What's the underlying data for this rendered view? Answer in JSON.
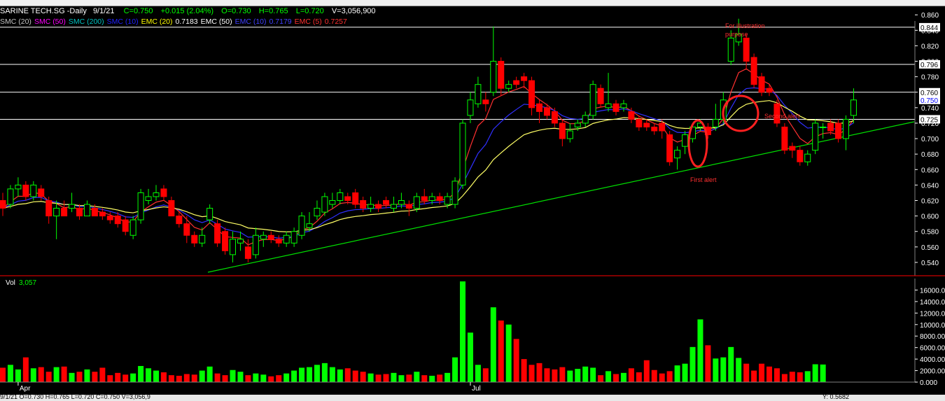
{
  "header": {
    "ticker": "SARINE TECH.SG -Daily",
    "date": "9/1/21",
    "close": "C=0.750",
    "change": "+0.015 (2.04%)",
    "open": "O=0.730",
    "high": "H=0.765",
    "low": "L=0.720",
    "volume": "V=3,056,900"
  },
  "indicators": [
    {
      "label": "SMC (20)",
      "color": "#c0c0c0"
    },
    {
      "label": "SMC (50)",
      "color": "#ff00ff"
    },
    {
      "label": "SMC (200)",
      "color": "#00c0c0"
    },
    {
      "label": "SMC (10)",
      "color": "#2020ff"
    },
    {
      "label": "EMC (20)",
      "color": "#ffff00"
    },
    {
      "label": "0.7183",
      "color": "#ffffff"
    },
    {
      "label": "EMC (50)",
      "color": "#ffffff"
    },
    {
      "label": "EMC (10)",
      "color": "#4040ff"
    },
    {
      "label": "0.7179",
      "color": "#4040ff"
    },
    {
      "label": "EMC (5)",
      "color": "#ff3030"
    },
    {
      "label": "0.7257",
      "color": "#ff3030"
    }
  ],
  "annotations": {
    "illustration": "For illustration purpose",
    "first_alert": "First alert",
    "second_alert": "Second alert"
  },
  "volume_label": {
    "name": "Vol",
    "value": "3,057"
  },
  "x_labels": [
    "Apr",
    "Jul"
  ],
  "statusbar": {
    "left": "9/1/21   O=0.730   H=0.765   L=0.720   C=0.750   V=3,056,9",
    "right": "Y: 0.5682"
  },
  "colors": {
    "up": "#00ff00",
    "down": "#ff0000",
    "trendline": "#00e000",
    "grid": "#ffffff",
    "ema5": "#ff3030",
    "ema10": "#3030ff",
    "ema20": "#ffff66",
    "alert_circle": "#ff2020"
  },
  "chart_data": [
    {
      "type": "candlestick",
      "title": "SARINE TECH.SG -Daily",
      "ylim": [
        0.53,
        0.862
      ],
      "yticks": [
        0.54,
        0.56,
        0.58,
        0.6,
        0.62,
        0.64,
        0.66,
        0.68,
        0.7,
        0.72,
        0.74,
        0.76,
        0.78,
        0.8,
        0.82,
        0.84,
        0.86
      ],
      "ytick_labels": [
        "0.540",
        "0.560",
        "0.580",
        "0.600",
        "0.620",
        "0.640",
        "0.660",
        "0.680",
        "0.700",
        "0.720",
        "0.740",
        "0.760",
        "0.780",
        "0.800",
        "0.820",
        "0.840",
        "0.860"
      ],
      "horizontal_levels": [
        {
          "value": 0.844,
          "label": "0.844"
        },
        {
          "value": 0.796,
          "label": "0.796"
        },
        {
          "value": 0.76,
          "label": "0.760"
        },
        {
          "value": 0.725,
          "label": "0.725"
        }
      ],
      "last_price": {
        "value": 0.75,
        "label": "0.750"
      },
      "bars": [
        [
          0.62,
          0.61,
          0.63,
          0.6
        ],
        [
          0.615,
          0.635,
          0.64,
          0.61
        ],
        [
          0.635,
          0.64,
          0.65,
          0.625
        ],
        [
          0.64,
          0.625,
          0.645,
          0.62
        ],
        [
          0.625,
          0.64,
          0.645,
          0.62
        ],
        [
          0.635,
          0.625,
          0.64,
          0.62
        ],
        [
          0.62,
          0.6,
          0.625,
          0.59
        ],
        [
          0.6,
          0.61,
          0.62,
          0.57
        ],
        [
          0.61,
          0.6,
          0.62,
          0.6
        ],
        [
          0.61,
          0.615,
          0.63,
          0.605
        ],
        [
          0.61,
          0.6,
          0.615,
          0.595
        ],
        [
          0.6,
          0.615,
          0.62,
          0.6
        ],
        [
          0.61,
          0.6,
          0.615,
          0.6
        ],
        [
          0.605,
          0.6,
          0.61,
          0.595
        ],
        [
          0.6,
          0.595,
          0.605,
          0.59
        ],
        [
          0.6,
          0.59,
          0.605,
          0.585
        ],
        [
          0.595,
          0.58,
          0.6,
          0.575
        ],
        [
          0.575,
          0.595,
          0.6,
          0.57
        ],
        [
          0.595,
          0.63,
          0.635,
          0.59
        ],
        [
          0.62,
          0.625,
          0.635,
          0.615
        ],
        [
          0.625,
          0.63,
          0.64,
          0.62
        ],
        [
          0.635,
          0.625,
          0.64,
          0.62
        ],
        [
          0.62,
          0.6,
          0.625,
          0.6
        ],
        [
          0.6,
          0.59,
          0.605,
          0.585
        ],
        [
          0.59,
          0.575,
          0.6,
          0.565
        ],
        [
          0.575,
          0.565,
          0.58,
          0.56
        ],
        [
          0.565,
          0.575,
          0.585,
          0.56
        ],
        [
          0.595,
          0.61,
          0.615,
          0.59
        ],
        [
          0.59,
          0.565,
          0.595,
          0.56
        ],
        [
          0.58,
          0.555,
          0.585,
          0.55
        ],
        [
          0.55,
          0.57,
          0.58,
          0.54
        ],
        [
          0.565,
          0.57,
          0.58,
          0.555
        ],
        [
          0.56,
          0.545,
          0.57,
          0.54
        ],
        [
          0.55,
          0.575,
          0.585,
          0.545
        ],
        [
          0.57,
          0.575,
          0.58,
          0.56
        ],
        [
          0.575,
          0.57,
          0.58,
          0.565
        ],
        [
          0.57,
          0.565,
          0.575,
          0.56
        ],
        [
          0.565,
          0.575,
          0.58,
          0.56
        ],
        [
          0.565,
          0.58,
          0.585,
          0.56
        ],
        [
          0.575,
          0.6,
          0.605,
          0.57
        ],
        [
          0.585,
          0.59,
          0.605,
          0.58
        ],
        [
          0.6,
          0.61,
          0.62,
          0.595
        ],
        [
          0.605,
          0.625,
          0.63,
          0.6
        ],
        [
          0.615,
          0.62,
          0.63,
          0.61
        ],
        [
          0.62,
          0.63,
          0.635,
          0.615
        ],
        [
          0.625,
          0.62,
          0.63,
          0.615
        ],
        [
          0.63,
          0.615,
          0.635,
          0.61
        ],
        [
          0.62,
          0.61,
          0.625,
          0.605
        ],
        [
          0.61,
          0.615,
          0.625,
          0.605
        ],
        [
          0.615,
          0.61,
          0.62,
          0.605
        ],
        [
          0.62,
          0.615,
          0.625,
          0.61
        ],
        [
          0.61,
          0.615,
          0.625,
          0.605
        ],
        [
          0.615,
          0.62,
          0.63,
          0.61
        ],
        [
          0.615,
          0.61,
          0.62,
          0.6
        ],
        [
          0.61,
          0.625,
          0.63,
          0.605
        ],
        [
          0.625,
          0.62,
          0.635,
          0.615
        ],
        [
          0.62,
          0.625,
          0.63,
          0.615
        ],
        [
          0.625,
          0.62,
          0.63,
          0.615
        ],
        [
          0.615,
          0.625,
          0.63,
          0.61
        ],
        [
          0.615,
          0.645,
          0.65,
          0.61
        ],
        [
          0.64,
          0.72,
          0.725,
          0.635
        ],
        [
          0.73,
          0.75,
          0.76,
          0.72
        ],
        [
          0.745,
          0.77,
          0.78,
          0.74
        ],
        [
          0.75,
          0.745,
          0.76,
          0.735
        ],
        [
          0.76,
          0.8,
          0.845,
          0.755
        ],
        [
          0.8,
          0.765,
          0.805,
          0.755
        ],
        [
          0.765,
          0.77,
          0.775,
          0.76
        ],
        [
          0.775,
          0.77,
          0.78,
          0.765
        ],
        [
          0.78,
          0.775,
          0.785,
          0.765
        ],
        [
          0.775,
          0.74,
          0.78,
          0.73
        ],
        [
          0.745,
          0.735,
          0.75,
          0.72
        ],
        [
          0.74,
          0.73,
          0.745,
          0.725
        ],
        [
          0.735,
          0.72,
          0.74,
          0.715
        ],
        [
          0.72,
          0.7,
          0.725,
          0.69
        ],
        [
          0.7,
          0.71,
          0.72,
          0.695
        ],
        [
          0.715,
          0.72,
          0.725,
          0.71
        ],
        [
          0.72,
          0.73,
          0.735,
          0.715
        ],
        [
          0.73,
          0.77,
          0.775,
          0.725
        ],
        [
          0.765,
          0.745,
          0.77,
          0.74
        ],
        [
          0.74,
          0.745,
          0.785,
          0.735
        ],
        [
          0.745,
          0.735,
          0.75,
          0.73
        ],
        [
          0.74,
          0.745,
          0.75,
          0.735
        ],
        [
          0.735,
          0.725,
          0.74,
          0.72
        ],
        [
          0.725,
          0.715,
          0.73,
          0.71
        ],
        [
          0.72,
          0.715,
          0.725,
          0.71
        ],
        [
          0.715,
          0.71,
          0.72,
          0.705
        ],
        [
          0.72,
          0.71,
          0.725,
          0.7
        ],
        [
          0.705,
          0.67,
          0.71,
          0.665
        ],
        [
          0.675,
          0.685,
          0.69,
          0.66
        ],
        [
          0.69,
          0.705,
          0.71,
          0.68
        ],
        [
          0.7,
          0.715,
          0.72,
          0.695
        ],
        [
          0.715,
          0.72,
          0.725,
          0.71
        ],
        [
          0.715,
          0.705,
          0.72,
          0.7
        ],
        [
          0.715,
          0.725,
          0.745,
          0.71
        ],
        [
          0.725,
          0.75,
          0.76,
          0.72
        ],
        [
          0.8,
          0.83,
          0.84,
          0.795
        ],
        [
          0.825,
          0.835,
          0.855,
          0.82
        ],
        [
          0.83,
          0.8,
          0.835,
          0.79
        ],
        [
          0.805,
          0.77,
          0.81,
          0.765
        ],
        [
          0.78,
          0.76,
          0.785,
          0.755
        ],
        [
          0.765,
          0.76,
          0.77,
          0.755
        ],
        [
          0.745,
          0.72,
          0.75,
          0.715
        ],
        [
          0.715,
          0.685,
          0.72,
          0.68
        ],
        [
          0.69,
          0.685,
          0.695,
          0.675
        ],
        [
          0.685,
          0.67,
          0.69,
          0.665
        ],
        [
          0.67,
          0.68,
          0.685,
          0.665
        ],
        [
          0.685,
          0.72,
          0.725,
          0.68
        ],
        [
          0.715,
          0.715,
          0.72,
          0.7
        ],
        [
          0.72,
          0.71,
          0.725,
          0.705
        ],
        [
          0.72,
          0.7,
          0.725,
          0.695
        ],
        [
          0.7,
          0.725,
          0.73,
          0.685
        ],
        [
          0.73,
          0.75,
          0.765,
          0.72
        ]
      ],
      "xlabels": [
        {
          "label": "Apr",
          "index": 2
        },
        {
          "label": "Jul",
          "index": 61
        }
      ]
    },
    {
      "type": "bar",
      "title": "Vol",
      "ylim": [
        0,
        18000
      ],
      "yticks": [
        0,
        2000,
        4000,
        6000,
        8000,
        10000,
        12000,
        14000,
        16000
      ],
      "ytick_labels": [
        "0.000",
        "2000.00",
        "4000.00",
        "6000.00",
        "8000.00",
        "10000.00",
        "12000.00",
        "14000.00",
        "16000.00"
      ],
      "values": [
        2500,
        3000,
        2200,
        4300,
        2400,
        2600,
        1800,
        2600,
        2700,
        1600,
        1800,
        2200,
        1800,
        2500,
        1200,
        1600,
        1300,
        1500,
        2800,
        2400,
        2000,
        1700,
        1200,
        1100,
        1400,
        1300,
        2000,
        2700,
        1500,
        1200,
        2100,
        1800,
        1200,
        1500,
        1300,
        1000,
        1200,
        1500,
        2000,
        2500,
        2600,
        3000,
        3300,
        2600,
        2200,
        2400,
        2000,
        1800,
        1500,
        1300,
        1400,
        1600,
        1200,
        1300,
        1800,
        1200,
        1100,
        1300,
        1600,
        4300,
        17500,
        8600,
        3000,
        2400,
        13000,
        10700,
        10000,
        7500,
        4000,
        3000,
        3300,
        2400,
        2200,
        2600,
        2000,
        2300,
        2700,
        2500,
        1200,
        1900,
        1400,
        1600,
        2400,
        1700,
        3800,
        2100,
        1500,
        1900,
        2900,
        3200,
        6100,
        10900,
        6400,
        4100,
        4300,
        6100,
        4200,
        3200,
        2000,
        3200,
        2700,
        2400,
        1400,
        1800,
        1700,
        1900,
        3100,
        3057
      ],
      "last_value_label": "3,057"
    }
  ]
}
